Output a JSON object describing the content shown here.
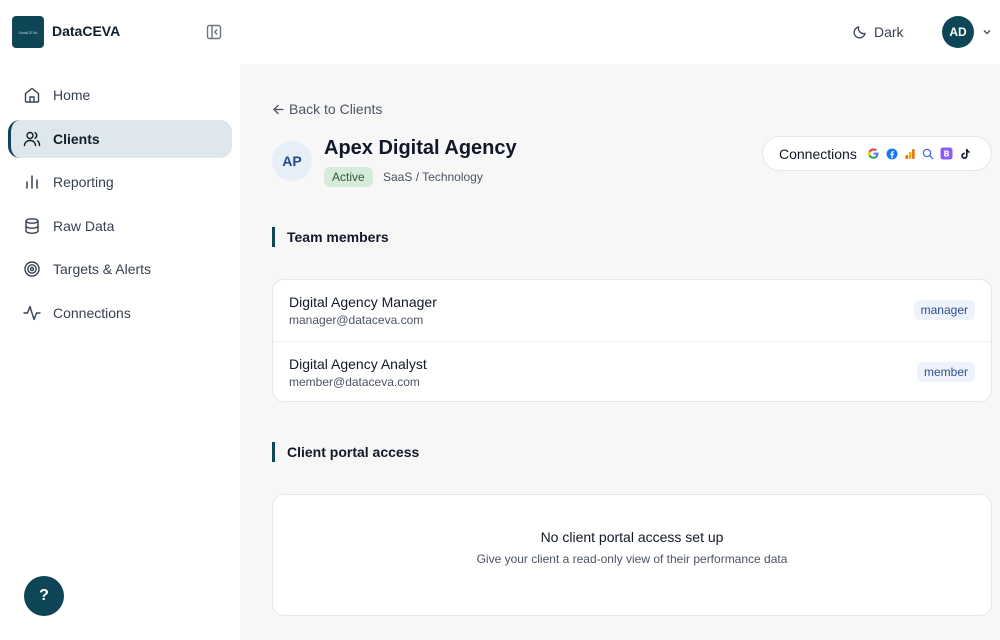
{
  "brand": {
    "name": "DataCEVA",
    "logo_text": "DataCEVA"
  },
  "header": {
    "theme_label": "Dark",
    "user_initials": "AD"
  },
  "sidebar": {
    "items": [
      {
        "label": "Home",
        "icon": "home-icon"
      },
      {
        "label": "Clients",
        "icon": "users-icon",
        "active": true
      },
      {
        "label": "Reporting",
        "icon": "bar-chart-icon"
      },
      {
        "label": "Raw Data",
        "icon": "database-icon"
      },
      {
        "label": "Targets & Alerts",
        "icon": "target-icon"
      },
      {
        "label": "Connections",
        "icon": "activity-icon"
      }
    ],
    "help_label": "?"
  },
  "main": {
    "back_label": "Back to Clients",
    "client": {
      "initials": "AP",
      "name": "Apex Digital Agency",
      "status": "Active",
      "industry": "SaaS / Technology"
    },
    "connections_label": "Connections",
    "connections_icons": [
      "google-icon",
      "facebook-icon",
      "analytics-icon",
      "search-console-icon",
      "bing-icon",
      "tiktok-icon"
    ],
    "team_section_title": "Team members",
    "team_members": [
      {
        "name": "Digital Agency Manager",
        "email": "manager@dataceva.com",
        "role": "manager"
      },
      {
        "name": "Digital Agency Analyst",
        "email": "member@dataceva.com",
        "role": "member"
      }
    ],
    "portal_section_title": "Client portal access",
    "portal_empty_title": "No client portal access set up",
    "portal_empty_subtitle": "Give your client a read-only view of their performance data"
  },
  "colors": {
    "brand": "#0f4657",
    "active_nav_bg": "#dde7ec",
    "status_green_bg": "#d6ebd9",
    "role_badge_bg": "#eef2fb"
  }
}
